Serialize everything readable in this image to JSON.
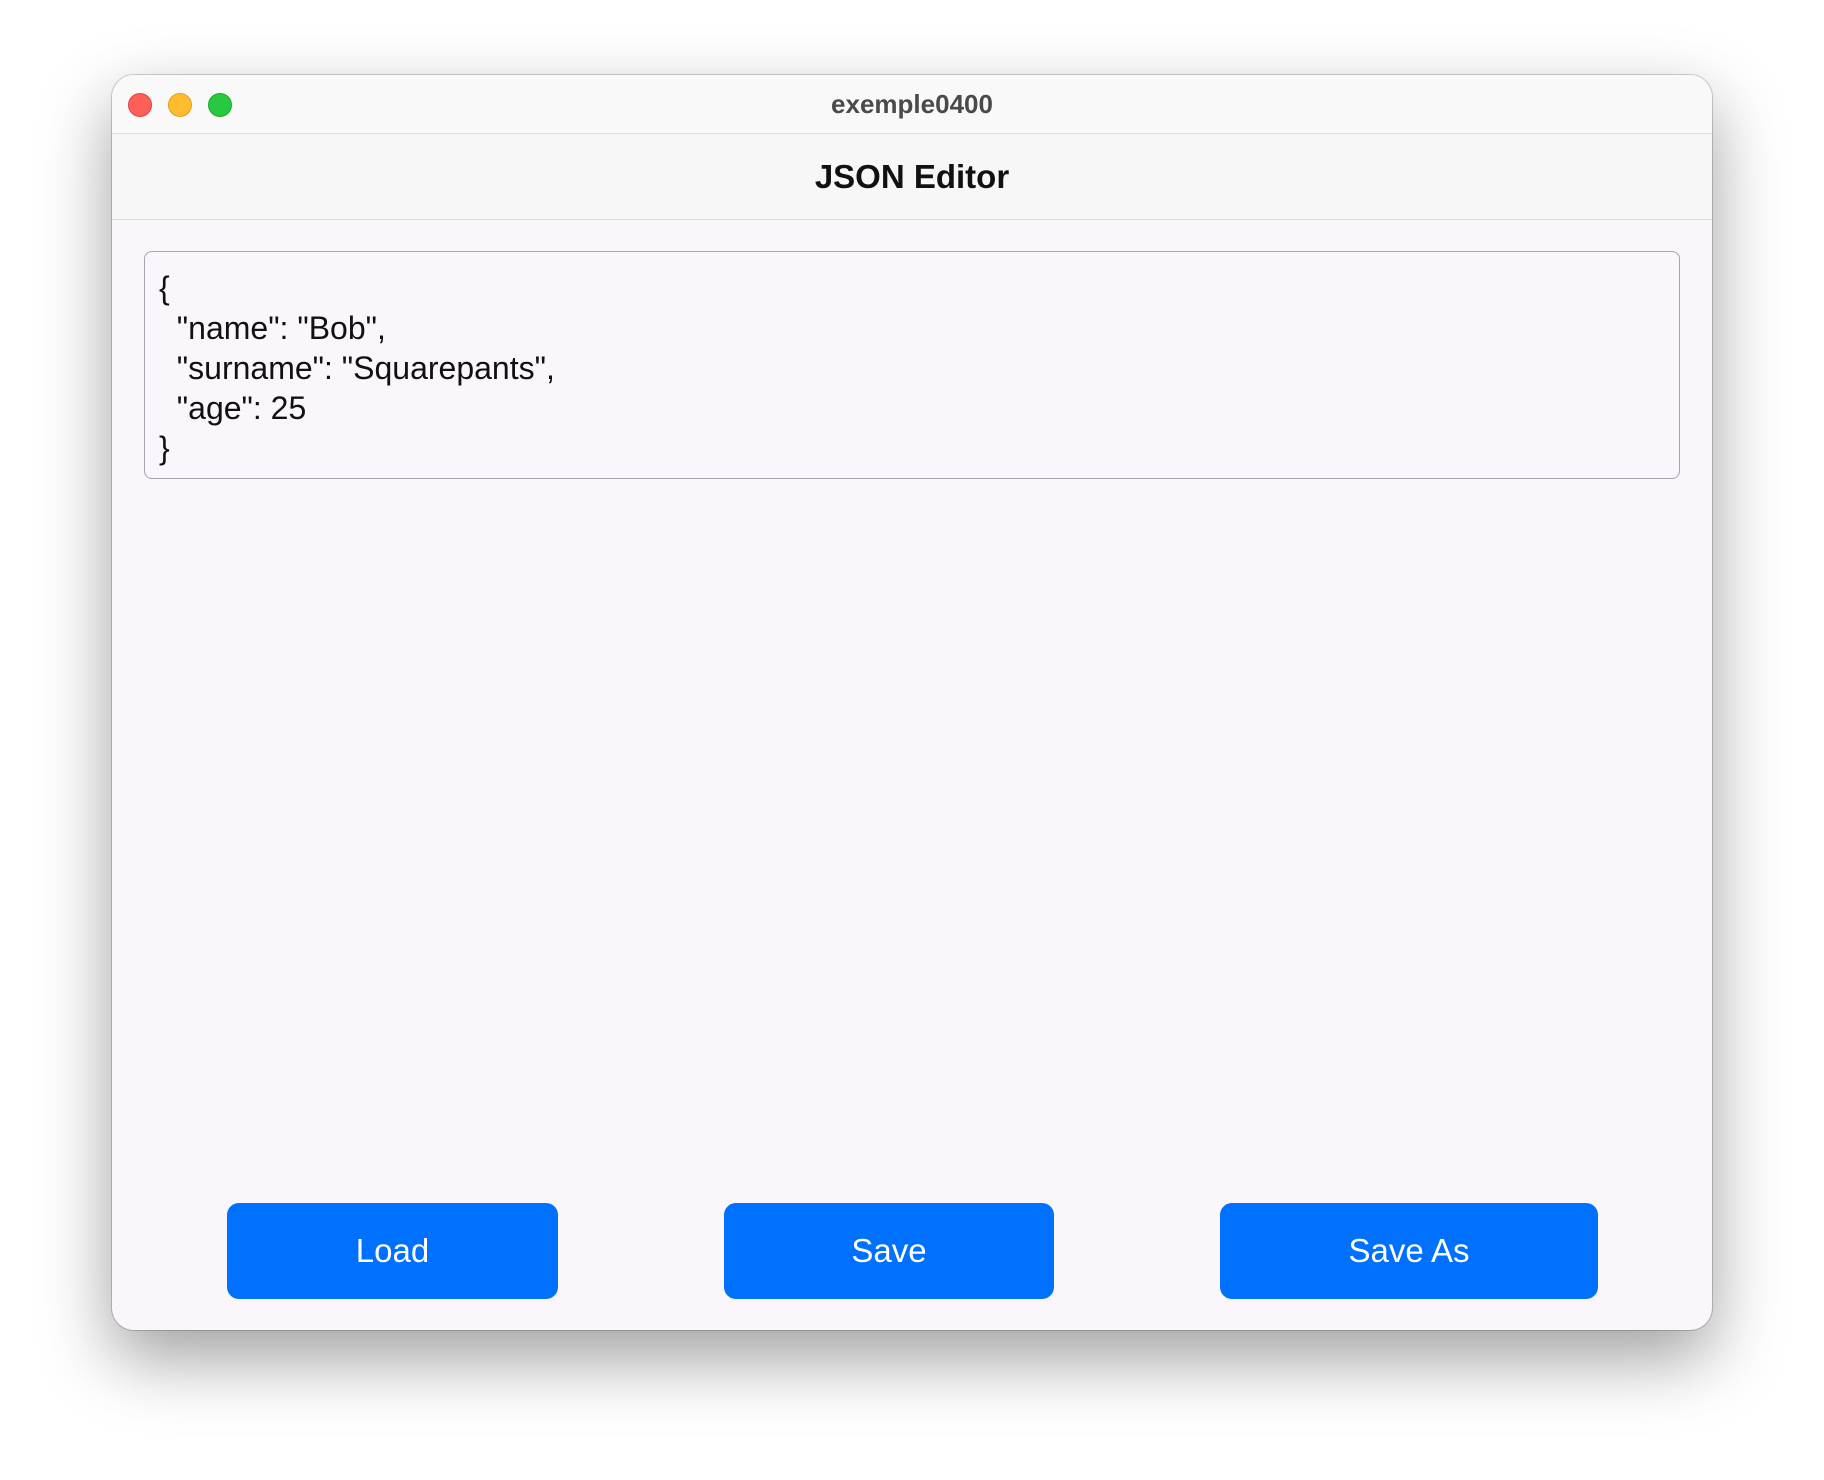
{
  "window": {
    "title": "exemple0400"
  },
  "header": {
    "title": "JSON Editor"
  },
  "editor": {
    "content": "{\n  \"name\": \"Bob\",\n  \"surname\": \"Squarepants\",\n  \"age\": 25\n}"
  },
  "actions": {
    "load_label": "Load",
    "save_label": "Save",
    "save_as_label": "Save As"
  },
  "colors": {
    "button_blue": "#0070ff",
    "content_background": "#fbf5fc",
    "traffic_close": "#fe5f57",
    "traffic_minimize": "#febc2e",
    "traffic_zoom": "#28c840"
  }
}
